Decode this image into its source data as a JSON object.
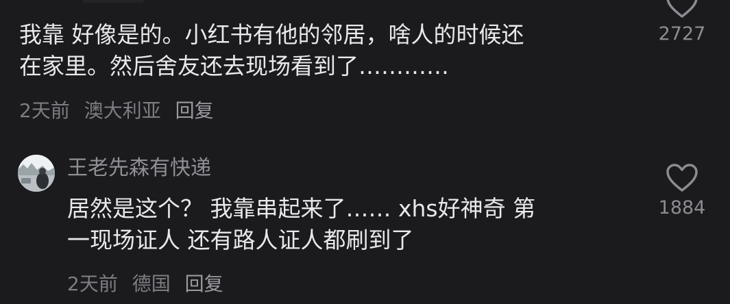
{
  "comments": [
    {
      "text_line1": "我靠 好像是的。小红书有他的邻居，啥人的时候还",
      "text_line2": "在家里。然后舍友还去现场看到了…………",
      "time": "2天前",
      "location": "澳大利亚",
      "reply_label": "回复",
      "like_count": "2727",
      "like_icon": "heart-outline-icon"
    },
    {
      "username": "王老先森有快递",
      "text_line1": "居然是这个？ 我靠串起来了…… xhs好神奇 第",
      "text_line2": "一现场证人 还有路人证人都刷到了",
      "time": "2天前",
      "location": "德国",
      "reply_label": "回复",
      "like_count": "1884",
      "like_icon": "heart-outline-icon"
    }
  ],
  "colors": {
    "background": "#1b1b1e",
    "text_primary": "#e9e9ec",
    "text_secondary": "#7d7d83"
  }
}
